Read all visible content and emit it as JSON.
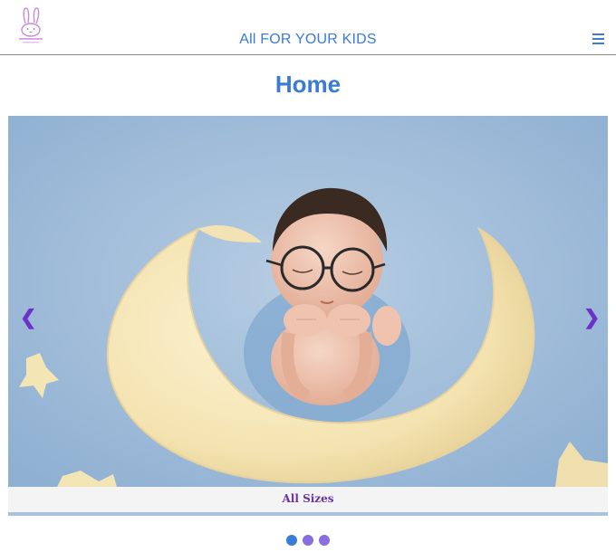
{
  "header": {
    "logo_icon": "bunny-logo-icon",
    "title": "All FOR YOUR KIDS",
    "menu_icon": "hamburger-menu-icon"
  },
  "page": {
    "title": "Home"
  },
  "carousel": {
    "slide_image": "baby-with-glasses-on-moon-pillow",
    "caption": "All Sizes",
    "prev_icon": "chevron-left-icon",
    "next_icon": "chevron-right-icon",
    "prev_glyph": "❮",
    "next_glyph": "❯",
    "dots": [
      {
        "state": "active",
        "color": "#3a7bd5"
      },
      {
        "state": "inactive",
        "color": "#8a6ee0"
      },
      {
        "state": "inactive",
        "color": "#8a6ee0"
      }
    ]
  },
  "colors": {
    "accent": "#3a7bd5",
    "arrow": "#6a33c8",
    "caption": "#6a33a8"
  }
}
